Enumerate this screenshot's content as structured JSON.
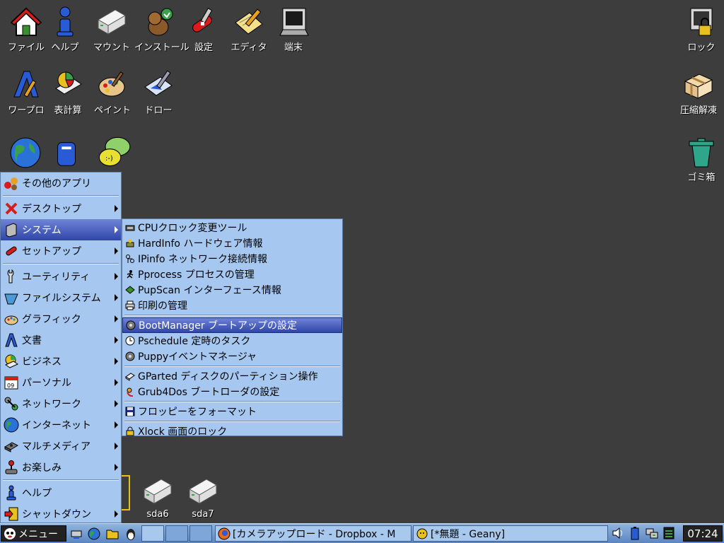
{
  "desktop": {
    "icons": [
      {
        "label": "ファイル",
        "icon": "home-icon"
      },
      {
        "label": "ヘルプ",
        "icon": "info-icon"
      },
      {
        "label": "マウント",
        "icon": "drive-icon"
      },
      {
        "label": "インストール",
        "icon": "install-icon"
      },
      {
        "label": "設定",
        "icon": "swiss-knife-icon"
      },
      {
        "label": "エディタ",
        "icon": "edit-icon"
      },
      {
        "label": "端末",
        "icon": "terminal-icon"
      },
      {
        "label": "ロック",
        "icon": "lock-icon"
      },
      {
        "label": "ワープロ",
        "icon": "wordprocessor-icon"
      },
      {
        "label": "表計算",
        "icon": "spreadsheet-icon"
      },
      {
        "label": "ペイント",
        "icon": "palette-icon"
      },
      {
        "label": "ドロー",
        "icon": "draw-icon"
      },
      {
        "label": "圧縮解凍",
        "icon": "archive-icon"
      },
      {
        "label": "ゴミ箱",
        "icon": "trash-icon"
      },
      {
        "label": "sda6",
        "icon": "drive-icon"
      },
      {
        "label": "sda7",
        "icon": "drive-icon"
      }
    ]
  },
  "menu": {
    "items": [
      {
        "label": "その他のアプリ",
        "icon": "apps-icon"
      },
      {
        "label": "デスクトップ",
        "icon": "desktop-icon"
      },
      {
        "label": "システム",
        "icon": "system-icon"
      },
      {
        "label": "セットアップ",
        "icon": "setup-icon"
      },
      {
        "label": "ユーティリティ",
        "icon": "utility-icon"
      },
      {
        "label": "ファイルシステム",
        "icon": "filesystem-icon"
      },
      {
        "label": "グラフィック",
        "icon": "graphic-icon"
      },
      {
        "label": "文書",
        "icon": "document-icon"
      },
      {
        "label": "ビジネス",
        "icon": "business-icon"
      },
      {
        "label": "パーソナル",
        "icon": "calendar-icon"
      },
      {
        "label": "ネットワーク",
        "icon": "network-icon"
      },
      {
        "label": "インターネット",
        "icon": "globe-icon"
      },
      {
        "label": "マルチメディア",
        "icon": "multimedia-icon"
      },
      {
        "label": "お楽しみ",
        "icon": "joystick-icon"
      },
      {
        "label": "ヘルプ",
        "icon": "help-icon"
      },
      {
        "label": "シャットダウン",
        "icon": "shutdown-icon"
      }
    ]
  },
  "submenu": {
    "items": [
      {
        "label": "CPUクロック変更ツール",
        "icon": "cpu-icon"
      },
      {
        "label": "HardInfo ハードウェア情報",
        "icon": "hardinfo-icon"
      },
      {
        "label": "IPinfo ネットワーク接続情報",
        "icon": "ipinfo-icon"
      },
      {
        "label": "Pprocess プロセスの管理",
        "icon": "process-icon"
      },
      {
        "label": "PupScan インターフェース情報",
        "icon": "pupscan-icon"
      },
      {
        "label": "印刷の管理",
        "icon": "printer-icon"
      },
      {
        "label": "BootManager ブートアップの設定",
        "icon": "bootmanager-icon"
      },
      {
        "label": "Pschedule 定時のタスク",
        "icon": "clock-icon"
      },
      {
        "label": "Puppyイベントマネージャ",
        "icon": "event-icon"
      },
      {
        "label": "GParted ディスクのパーティション操作",
        "icon": "gparted-icon"
      },
      {
        "label": "Grub4Dos ブートローダの設定",
        "icon": "grub-icon"
      },
      {
        "label": "フロッピーをフォーマット",
        "icon": "floppy-icon"
      },
      {
        "label": "Xlock 画面のロック",
        "icon": "lock-icon"
      }
    ]
  },
  "taskbar": {
    "menu_label": "メニュー",
    "tasks": [
      {
        "label": "[カメラアップロード - Dropbox - M",
        "icon": "firefox-icon"
      },
      {
        "label": "[*無題 - Geany]",
        "icon": "geany-icon"
      }
    ],
    "clock": "07:24"
  },
  "colors": {
    "desktop": "#3d3d3d",
    "menu_bg": "#a6c8f0",
    "highlight": "#2f46a8"
  }
}
